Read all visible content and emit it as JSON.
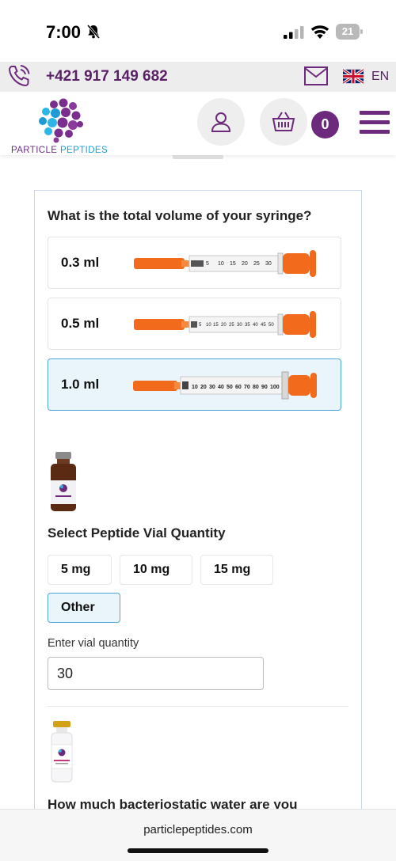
{
  "status_bar": {
    "time": "7:00",
    "battery": "21"
  },
  "contact": {
    "phone": "+421 917 149 682",
    "language": "EN"
  },
  "header": {
    "logo_main": "PARTICLE ",
    "logo_accent": "PEPTIDES",
    "cart_count": "0"
  },
  "calculator": {
    "syringe_question": "What is the total volume of your syringe?",
    "syringe_options": [
      {
        "label": "0.3 ml",
        "selected": false
      },
      {
        "label": "0.5 ml",
        "selected": false
      },
      {
        "label": "1.0 ml",
        "selected": true
      }
    ],
    "syringe_scales": {
      "s03": [
        "5",
        "10",
        "15",
        "20",
        "25",
        "30"
      ],
      "s05": [
        "5",
        "10",
        "15",
        "20",
        "25",
        "30",
        "35",
        "40",
        "45",
        "50"
      ],
      "s10": [
        "10",
        "20",
        "30",
        "40",
        "50",
        "60",
        "70",
        "80",
        "90",
        "100"
      ]
    },
    "vial_title": "Select Peptide Vial Quantity",
    "vial_options": [
      {
        "label": "5 mg",
        "selected": false
      },
      {
        "label": "10 mg",
        "selected": false
      },
      {
        "label": "15 mg",
        "selected": false
      },
      {
        "label": "Other",
        "selected": true
      }
    ],
    "vial_input_label": "Enter vial quantity",
    "vial_input_value": "30",
    "water_title": "How much bacteriostatic water are you"
  },
  "browser": {
    "url": "particlepeptides.com"
  },
  "colors": {
    "brand_purple": "#6d2a7c",
    "accent_blue": "#4ca8d8",
    "syringe_orange": "#f26a1b"
  }
}
